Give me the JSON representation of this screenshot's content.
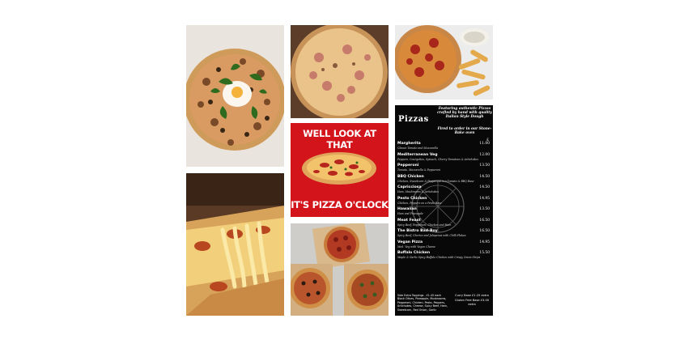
{
  "poster": {
    "top_text": "WELL LOOK AT THAT",
    "bottom_text": "IT'S PIZZA O'CLOCK"
  },
  "menu": {
    "title": "Pizzas",
    "tagline": "Featuring authentic Pizzas crafted by hand with quality Italian Style Dough",
    "tagline2": "Fired to order in our Stone-Bake oven",
    "currency": "£",
    "items": [
      {
        "name": "Margherita",
        "desc": "Classic Tomato and Mozzarella",
        "price": "11.00"
      },
      {
        "name": "Mediterranean Veg",
        "desc": "Peppers, Courgettes, Spinach, Cherry Tomatoes & Artichokes",
        "price": "12.00"
      },
      {
        "name": "Pepperoni",
        "desc": "Tomato, Mozzarella & Pepperoni",
        "price": "13.50"
      },
      {
        "name": "BBQ Chicken",
        "desc": "Chicken, Sweetcorn & Pepperoni in a Tomato & BBQ Base",
        "price": "14.50"
      },
      {
        "name": "Capricciosa",
        "desc": "Ham, Mushrooms & Artichokes",
        "price": "14.50"
      },
      {
        "name": "Pesto Chicken",
        "desc": "Chicken, Peppers on a Pesto Base",
        "price": "14.95"
      },
      {
        "name": "Hawaiian",
        "desc": "Ham and Pineapple",
        "price": "13.50"
      },
      {
        "name": "Meat Feast",
        "desc": "Spicy Beef, Pepperoni, Chicken and Ham",
        "price": "16.50"
      },
      {
        "name": "The Bistro Bad-Boy",
        "desc": "Spicy Beef, Chorizo and Jalapenos with Chilli Flakes",
        "price": "16.50"
      },
      {
        "name": "Vegan Pizza",
        "desc": "Med. Veg with Vegan Cheese",
        "price": "14.95"
      },
      {
        "name": "Buffalo Chicken",
        "desc": "Maple & Garlic Spicy Buffalo Chicken with Crispy Onion Strips",
        "price": "15.50"
      }
    ],
    "extras_left": "Side Extra Toppings - £1.45 each Black Olives, Pineapple, Mushrooms, Pepperoni, Chicken, Pesto, Peppers, Artichokes, Cheese, Spicy Beef, Ham, Sweetcorn, Red Onion, Garlic",
    "extras_right_1": "Curry Base £1.25 extra",
    "extras_right_2": "Gluten Free Base £3.00 extra"
  },
  "colors": {
    "poster_red": "#d3141b",
    "menu_bg": "#080808"
  }
}
